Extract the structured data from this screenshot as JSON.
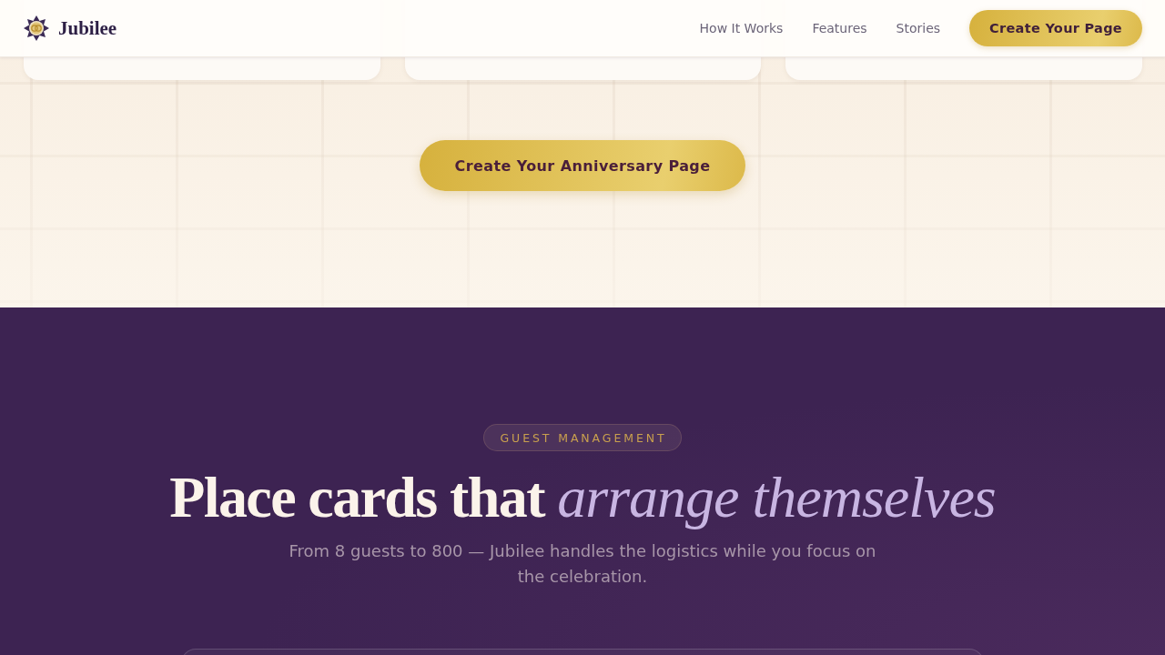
{
  "nav": {
    "brand": "Jubilee",
    "links": [
      "How It Works",
      "Features",
      "Stories"
    ],
    "button": "Create Your Page"
  },
  "cta_section": {
    "button": "Create Your Anniversary Page"
  },
  "guest_section": {
    "badge": "GUEST MANAGEMENT",
    "heading": "Place cards that *arrange themselves*",
    "subtitle": "From 8 guests to 800 — Jubilee handles the logistics while you focus on the celebration."
  }
}
